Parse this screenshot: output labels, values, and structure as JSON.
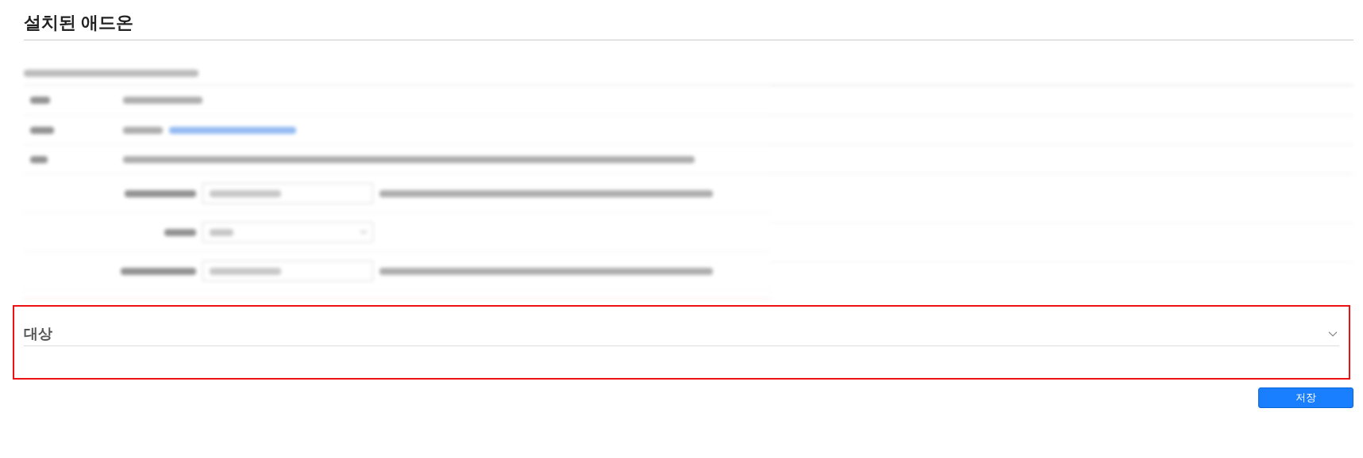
{
  "page_title": "설치된 애드온",
  "section": {
    "title": "대상"
  },
  "save_button": {
    "label": "저장"
  }
}
